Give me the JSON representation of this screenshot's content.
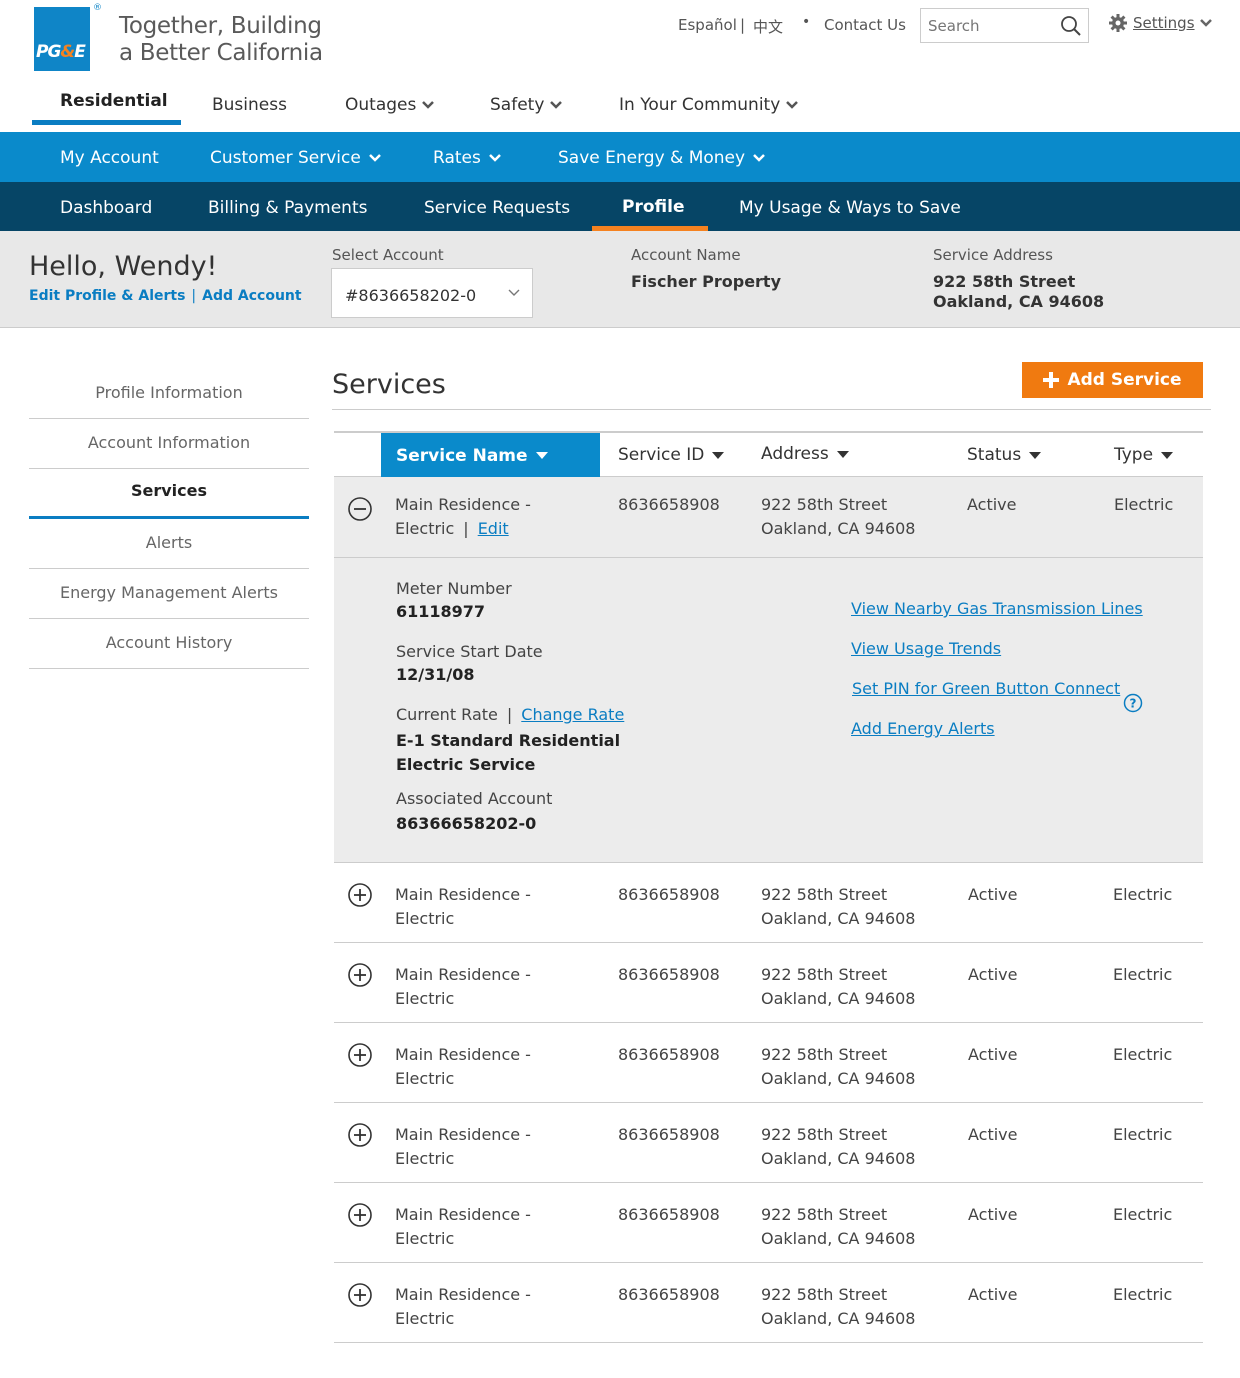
{
  "brand": {
    "logo_text": "PG&E",
    "tagline_line1": "Together, Building",
    "tagline_line2": "a Better California"
  },
  "utility": {
    "espanol": "Español",
    "separator": "|",
    "chinese": "中文",
    "bullet": "•",
    "contact": "Contact Us",
    "search_placeholder": "Search",
    "settings": "Settings"
  },
  "main_nav": [
    {
      "label": "Residential"
    },
    {
      "label": "Business"
    },
    {
      "label": "Outages"
    },
    {
      "label": "Safety"
    },
    {
      "label": "In Your Community"
    }
  ],
  "blue_nav": [
    {
      "label": "My Account"
    },
    {
      "label": "Customer Service"
    },
    {
      "label": "Rates"
    },
    {
      "label": "Save Energy & Money"
    }
  ],
  "dark_nav": [
    {
      "label": "Dashboard"
    },
    {
      "label": "Billing & Payments"
    },
    {
      "label": "Service Requests"
    },
    {
      "label": "Profile"
    },
    {
      "label": "My Usage & Ways to Save"
    }
  ],
  "account_bar": {
    "greeting": "Hello, Wendy!",
    "edit_profile": "Edit Profile & Alerts",
    "link_sep": "|",
    "add_account": "Add Account",
    "select_label": "Select Account",
    "selected_account": "#8636658202-0",
    "account_name_label": "Account Name",
    "account_name": "Fischer Property",
    "service_address_label": "Service Address",
    "service_address_line1": "922 58th Street",
    "service_address_line2": "Oakland, CA 94608"
  },
  "side_nav": [
    {
      "label": "Profile Information"
    },
    {
      "label": "Account Information"
    },
    {
      "label": "Services"
    },
    {
      "label": "Alerts"
    },
    {
      "label": "Energy Management Alerts"
    },
    {
      "label": "Account History"
    }
  ],
  "content": {
    "title": "Services",
    "add_button": "Add Service",
    "columns": [
      "Service Name",
      "Service ID",
      "Address",
      "Status",
      "Type"
    ],
    "rows": [
      {
        "name1": "Main Residence -",
        "name2": "Electric",
        "edit": "Edit",
        "sep": "|",
        "id": "8636658908",
        "addr1": "922 58th Street",
        "addr2": "Oakland, CA 94608",
        "status": "Active",
        "type": "Electric"
      },
      {
        "name1": "Main Residence -",
        "name2": "Electric",
        "id": "8636658908",
        "addr1": "922 58th Street",
        "addr2": "Oakland, CA 94608",
        "status": "Active",
        "type": "Electric"
      },
      {
        "name1": "Main Residence -",
        "name2": "Electric",
        "id": "8636658908",
        "addr1": "922 58th Street",
        "addr2": "Oakland, CA 94608",
        "status": "Active",
        "type": "Electric"
      },
      {
        "name1": "Main Residence -",
        "name2": "Electric",
        "id": "8636658908",
        "addr1": "922 58th Street",
        "addr2": "Oakland, CA 94608",
        "status": "Active",
        "type": "Electric"
      },
      {
        "name1": "Main Residence -",
        "name2": "Electric",
        "id": "8636658908",
        "addr1": "922 58th Street",
        "addr2": "Oakland, CA 94608",
        "status": "Active",
        "type": "Electric"
      },
      {
        "name1": "Main Residence -",
        "name2": "Electric",
        "id": "8636658908",
        "addr1": "922 58th Street",
        "addr2": "Oakland, CA 94608",
        "status": "Active",
        "type": "Electric"
      },
      {
        "name1": "Main Residence -",
        "name2": "Electric",
        "id": "8636658908",
        "addr1": "922 58th Street",
        "addr2": "Oakland, CA 94608",
        "status": "Active",
        "type": "Electric"
      }
    ],
    "detail": {
      "meter_label": "Meter Number",
      "meter_value": "61118977",
      "start_label": "Service Start Date",
      "start_value": "12/31/08",
      "rate_label": "Current Rate",
      "rate_sep": "|",
      "change_rate": "Change Rate",
      "rate_value_line1": "E-1 Standard Residential",
      "rate_value_line2": "Electric Service",
      "assoc_label": "Associated Account",
      "assoc_value": "86366658202-0",
      "links": [
        "View Nearby Gas Transmission Lines",
        "View Usage Trends",
        "Set PIN for Green Button Connect",
        "Add Energy Alerts"
      ]
    }
  },
  "colors": {
    "brand_blue": "#0a8acb",
    "dark_blue": "#064566",
    "orange": "#f07a10",
    "link": "#0a7dc2"
  }
}
